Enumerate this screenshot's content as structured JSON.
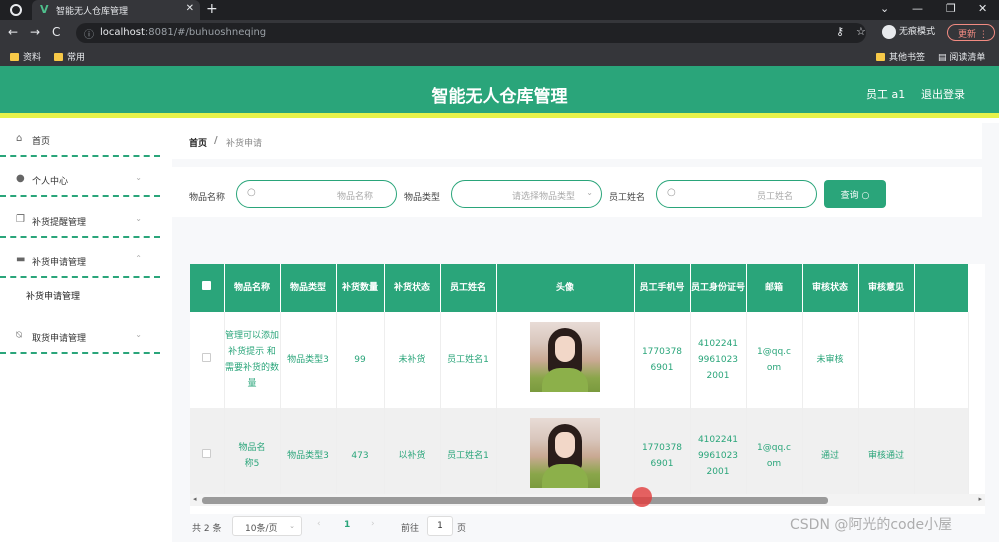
{
  "browser": {
    "tab_title": "智能无人仓库管理",
    "url_host": "localhost",
    "url_path": ":8081/#/buhuoshneqing",
    "incognito_label": "无痕模式",
    "update_label": "更新",
    "bookmarks": [
      "资料",
      "常用"
    ],
    "bookmarks_right": [
      "其他书签",
      "阅读清单"
    ]
  },
  "header": {
    "title": "智能无人仓库管理",
    "user": "员工 a1",
    "logout": "退出登录"
  },
  "sidebar": {
    "items": [
      {
        "label": "首页",
        "icon": "home-icon"
      },
      {
        "label": "个人中心",
        "icon": "user-icon"
      },
      {
        "label": "补货提醒管理",
        "icon": "copy-icon"
      },
      {
        "label": "补货申请管理",
        "icon": "briefcase-icon"
      },
      {
        "label": "取货申请管理",
        "icon": "bell-off-icon"
      }
    ],
    "sub_item": "补货申请管理"
  },
  "breadcrumb": {
    "home": "首页",
    "separator": "/",
    "current": "补货申请"
  },
  "search": {
    "item_name_label": "物品名称",
    "item_name_placeholder": "物品名称",
    "item_type_label": "物品类型",
    "item_type_placeholder": "请选择物品类型",
    "staff_name_label": "员工姓名",
    "staff_name_placeholder": "员工姓名",
    "query_label": "查询"
  },
  "table": {
    "headers": [
      "物品名称",
      "物品类型",
      "补货数量",
      "补货状态",
      "员工姓名",
      "头像",
      "员工手机号",
      "员工身份证号",
      "邮箱",
      "审核状态",
      "审核意见"
    ],
    "rows": [
      {
        "name": "管理可以添加补货提示 和需要补货的数量",
        "type": "物品类型3",
        "qty": "99",
        "status": "未补货",
        "staff": "员工姓名1",
        "phone": "17703786901",
        "idno": "410224199610232001",
        "email": "1@qq.com",
        "audit": "未审核",
        "opinion": ""
      },
      {
        "name": "物品名称5",
        "type": "物品类型3",
        "qty": "473",
        "status": "以补货",
        "staff": "员工姓名1",
        "phone": "17703786901",
        "idno": "410224199610232001",
        "email": "1@qq.com",
        "audit": "通过",
        "opinion": "审核通过"
      }
    ]
  },
  "pager": {
    "total": "共 2 条",
    "page_size": "10条/页",
    "current_page": "1",
    "goto_label": "前往",
    "goto_value": "1",
    "page_suffix": "页"
  },
  "watermark": "CSDN @阿光的code小屋",
  "colors": {
    "accent": "#2aa57a",
    "header_stripe": "#e6f24a"
  }
}
